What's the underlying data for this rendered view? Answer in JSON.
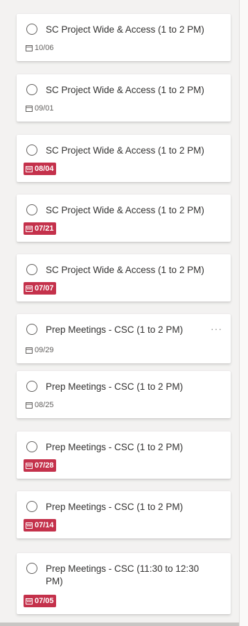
{
  "tasks": [
    {
      "title": "SC Project Wide & Access (1 to 2 PM)",
      "due": "10/06",
      "overdue": false,
      "show_more": false
    },
    {
      "title": "SC Project Wide & Access (1 to 2 PM)",
      "due": "09/01",
      "overdue": false,
      "show_more": false
    },
    {
      "title": "SC Project Wide & Access (1 to 2 PM)",
      "due": "08/04",
      "overdue": true,
      "show_more": false
    },
    {
      "title": "SC Project Wide & Access (1 to 2 PM)",
      "due": "07/21",
      "overdue": true,
      "show_more": false
    },
    {
      "title": "SC Project Wide & Access (1 to 2 PM)",
      "due": "07/07",
      "overdue": true,
      "show_more": false
    },
    {
      "title": "Prep Meetings - CSC (1 to 2 PM)",
      "due": "09/29",
      "overdue": false,
      "show_more": true
    },
    {
      "title": "Prep Meetings - CSC (1 to 2 PM)",
      "due": "08/25",
      "overdue": false,
      "show_more": false
    },
    {
      "title": "Prep Meetings - CSC (1 to 2 PM)",
      "due": "07/28",
      "overdue": true,
      "show_more": false
    },
    {
      "title": "Prep Meetings - CSC (1 to 2 PM)",
      "due": "07/14",
      "overdue": true,
      "show_more": false
    },
    {
      "title": "Prep Meetings - CSC (11:30 to 12:30 PM)",
      "due": "07/05",
      "overdue": true,
      "show_more": false
    }
  ],
  "more_glyph": "···",
  "colors": {
    "overdue_badge": "#c4314b",
    "board_background": "#f3f2f1",
    "card_background": "#ffffff"
  },
  "icons": {
    "checkbox": "circle-outline-icon",
    "due_date": "calendar-icon",
    "more": "ellipsis-icon"
  }
}
